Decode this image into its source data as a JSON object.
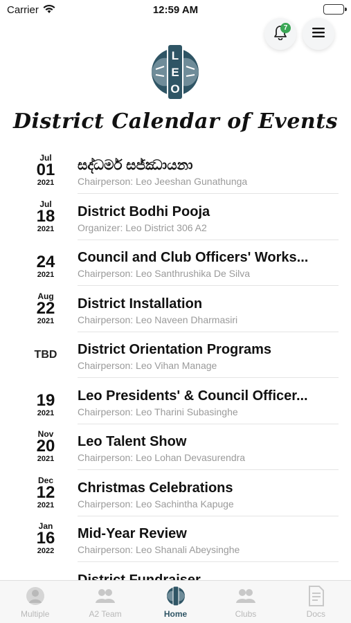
{
  "status_bar": {
    "carrier": "Carrier",
    "time": "12:59 AM"
  },
  "header": {
    "notification_count": "7",
    "notification_icon": "bell-icon",
    "menu_icon": "hamburger-menu-icon",
    "logo_letters": "LEO",
    "title": "District Calendar of Events"
  },
  "colors": {
    "brand": "#2f5565",
    "badge": "#3aa655",
    "subtitle": "#9a9a9a"
  },
  "events": [
    {
      "month": "Jul",
      "day": "01",
      "year": "2021",
      "title": "සද්ධර්ම සජ්ඣායනා",
      "subtitle": "Chairperson: Leo Jeeshan Gunathunga"
    },
    {
      "month": "Jul",
      "day": "18",
      "year": "2021",
      "title": "District Bodhi Pooja",
      "subtitle": "Organizer: Leo District 306 A2"
    },
    {
      "month": "",
      "day": "24",
      "year": "2021",
      "title": "Council and Club Officers' Works...",
      "subtitle": "Chairperson: Leo Santhrushika De Silva"
    },
    {
      "month": "Aug",
      "day": "22",
      "year": "2021",
      "title": "District Installation",
      "subtitle": "Chairperson: Leo Naveen Dharmasiri"
    },
    {
      "tbd": "TBD",
      "title": "District Orientation Programs",
      "subtitle": "Chairperson: Leo Vihan Manage"
    },
    {
      "month": "",
      "day": "19",
      "year": "2021",
      "title": "Leo Presidents' & Council Officer...",
      "subtitle": "Chairperson: Leo Tharini Subasinghe"
    },
    {
      "month": "Nov",
      "day": "20",
      "year": "2021",
      "title": "Leo Talent Show",
      "subtitle": "Chairperson: Leo Lohan Devasurendra"
    },
    {
      "month": "Dec",
      "day": "12",
      "year": "2021",
      "title": "Christmas Celebrations",
      "subtitle": "Chairperson: Leo Sachintha Kapuge"
    },
    {
      "month": "Jan",
      "day": "16",
      "year": "2022",
      "title": "Mid-Year Review",
      "subtitle": "Chairperson: Leo Shanali Abeysinghe"
    },
    {
      "month": "",
      "day": "",
      "year": "",
      "title": "District Fundraiser",
      "subtitle": ""
    }
  ],
  "tabbar": {
    "tabs": [
      {
        "label": "Multiple",
        "icon": "globe-person-icon"
      },
      {
        "label": "A2 Team",
        "icon": "team-icon"
      },
      {
        "label": "Home",
        "icon": "leo-logo-icon",
        "active": true
      },
      {
        "label": "Clubs",
        "icon": "clubs-icon"
      },
      {
        "label": "Docs",
        "icon": "document-icon"
      }
    ]
  }
}
